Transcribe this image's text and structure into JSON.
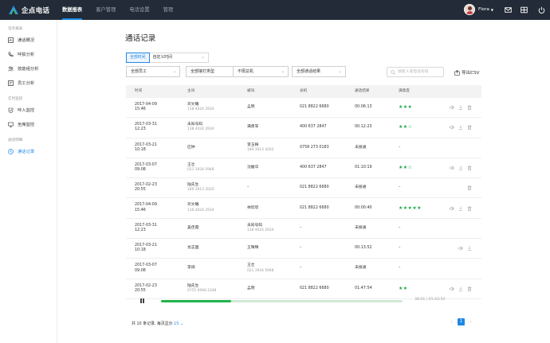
{
  "app": {
    "logo_text": "企点电话",
    "brand_color": "#1e88e5",
    "topbar_color": "#222b37",
    "star_color": "#1ea84b"
  },
  "nav": [
    {
      "label": "数据报表",
      "active": true
    },
    {
      "label": "客户管理",
      "active": false
    },
    {
      "label": "电话设置",
      "active": false
    },
    {
      "label": "管理",
      "active": false
    }
  ],
  "user": {
    "name": "Flora"
  },
  "top_icons": [
    "mail-icon",
    "grid-icon",
    "power-icon"
  ],
  "sidebar": {
    "groups": [
      {
        "title": "话务报表",
        "items": [
          {
            "label": "通话概况",
            "icon": "overview-icon"
          },
          {
            "label": "呼损分析",
            "icon": "phone-icon"
          },
          {
            "label": "技能组分析",
            "icon": "group-icon"
          },
          {
            "label": "员工分析",
            "icon": "staff-icon"
          }
        ]
      },
      {
        "title": "实时监控",
        "items": [
          {
            "label": "呼入监控",
            "icon": "inbound-icon"
          },
          {
            "label": "坐席监控",
            "icon": "seat-icon"
          }
        ]
      },
      {
        "title": "通话明细",
        "items": [
          {
            "label": "通话记录",
            "icon": "record-icon",
            "active": true
          }
        ]
      }
    ]
  },
  "page": {
    "title": "通话记录"
  },
  "time_filter": {
    "all_label": "全部时间",
    "custom_label": "自定义时间"
  },
  "filters": [
    {
      "label": "全部员工"
    },
    {
      "label": "全部接打类型"
    },
    {
      "label": "不限总机"
    },
    {
      "label": "全部通话结果"
    }
  ],
  "search": {
    "placeholder": "搜索人或电话号码"
  },
  "export": {
    "label": "导出CSV"
  },
  "table": {
    "columns": [
      "时间",
      "主叫",
      "被叫",
      "总机",
      "通话结果",
      "满意度"
    ],
    "rows": [
      {
        "date": "2017-04-09",
        "time": "15:46",
        "caller": "邓文曦",
        "caller_sub": "138 4024 2934",
        "callee": "孟晓",
        "callee_sub": "",
        "trunk": "021 8822 6680",
        "result": "00:06:13",
        "rating": "★★★",
        "actions": [
          "play-icon",
          "download-icon",
          "delete-icon"
        ]
      },
      {
        "date": "2017-03-31",
        "time": "12:23",
        "caller": "未知号码",
        "caller_sub": "138 4024 2934",
        "callee": "满勇军",
        "callee_sub": "",
        "trunk": "400 637 2847",
        "result": "00:12:23",
        "rating": "★★☆",
        "actions": [
          "play-icon",
          "download-icon",
          "delete-icon"
        ]
      },
      {
        "date": "2017-03-21",
        "time": "10:18",
        "caller": "应钟",
        "caller_sub": "",
        "callee": "李玉梅",
        "callee_sub": "189 3013 4202",
        "trunk": "0758 273 0183",
        "result": "未接通",
        "rating": "–",
        "actions": []
      },
      {
        "date": "2017-03-07",
        "time": "09:08",
        "caller": "王壮",
        "caller_sub": "021 3934 5948",
        "callee": "沈媛华",
        "callee_sub": "",
        "trunk": "400 637 2847",
        "result": "01:10:19",
        "rating": "★★☆",
        "actions": [
          "play-icon",
          "download-icon",
          "delete-icon"
        ]
      },
      {
        "date": "2017-02-23",
        "time": "20:55",
        "caller": "陆先生",
        "caller_sub": "189 3013 2020",
        "callee": "–",
        "callee_sub": "",
        "trunk": "021 8822 6680",
        "result": "未接通",
        "rating": "–",
        "actions": [
          "delete-icon"
        ]
      },
      {
        "date": "2017-04-09",
        "time": "15:46",
        "caller": "邓文曦",
        "caller_sub": "138 4024 2934",
        "callee": "林欣欣",
        "callee_sub": "",
        "trunk": "021 8822 6680",
        "result": "00:00:40",
        "rating": "★★★★★",
        "actions": [
          "play-icon",
          "download-icon",
          "delete-icon"
        ]
      },
      {
        "date": "2017-03-31",
        "time": "12:23",
        "caller": "吴佳霞",
        "caller_sub": "",
        "callee": "未知号码",
        "callee_sub": "138 4024 2934",
        "trunk": "–",
        "result": "未接通",
        "rating": "–",
        "actions": []
      },
      {
        "date": "2017-03-21",
        "time": "10:18",
        "caller": "龙志国",
        "caller_sub": "",
        "callee": "王晴晴",
        "callee_sub": "",
        "trunk": "–",
        "result": "00:13:52",
        "rating": "–",
        "actions": [
          "play-icon",
          "download-icon"
        ]
      },
      {
        "date": "2017-03-07",
        "time": "09:08",
        "caller": "李阔",
        "caller_sub": "",
        "callee": "王壮",
        "callee_sub": "021 3934 5948",
        "trunk": "–",
        "result": "未接通",
        "rating": "–",
        "actions": []
      },
      {
        "date": "2017-02-23",
        "time": "20:55",
        "caller": "陆先生",
        "caller_sub": "0755 6948 2348",
        "callee": "孟晓",
        "callee_sub": "",
        "trunk": "021 8822 6680",
        "result": "01:47:54",
        "rating": "★★",
        "actions": [
          "play-icon",
          "download-icon",
          "delete-icon"
        ]
      }
    ]
  },
  "player": {
    "time": "38:01 / 01:43:54",
    "progress": 0.29
  },
  "footer": {
    "summary_prefix": "共 10 条记录, 每页显示",
    "page_size": "15",
    "current_page": "1"
  }
}
